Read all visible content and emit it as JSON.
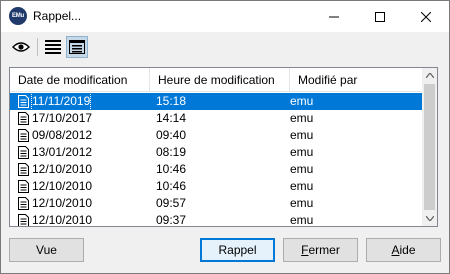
{
  "window": {
    "app_icon_text": "EMu",
    "title": "Rappel..."
  },
  "toolbar": {
    "view_icon": "eye-icon",
    "list_icon": "list-view-icon",
    "details_icon": "details-view-icon"
  },
  "list": {
    "columns": [
      "Date de modification",
      "Heure de modification",
      "Modifié par"
    ],
    "rows": [
      {
        "date": "11/11/2019",
        "time": "15:18",
        "user": "emu",
        "selected": true
      },
      {
        "date": "17/10/2017",
        "time": "14:14",
        "user": "emu",
        "selected": false
      },
      {
        "date": "09/08/2012",
        "time": "09:40",
        "user": "emu",
        "selected": false
      },
      {
        "date": "13/01/2012",
        "time": "08:19",
        "user": "emu",
        "selected": false
      },
      {
        "date": "12/10/2010",
        "time": "10:46",
        "user": "emu",
        "selected": false
      },
      {
        "date": "12/10/2010",
        "time": "10:46",
        "user": "emu",
        "selected": false
      },
      {
        "date": "12/10/2010",
        "time": "09:57",
        "user": "emu",
        "selected": false
      },
      {
        "date": "12/10/2010",
        "time": "09:37",
        "user": "emu",
        "selected": false
      }
    ]
  },
  "buttons": {
    "vue": "Vue",
    "rappel": "Rappel",
    "fermer_first": "F",
    "fermer_rest": "ermer",
    "aide_first": "A",
    "aide_rest": "ide"
  },
  "colors": {
    "selection": "#0078d7",
    "default_button_border": "#0078d7"
  }
}
